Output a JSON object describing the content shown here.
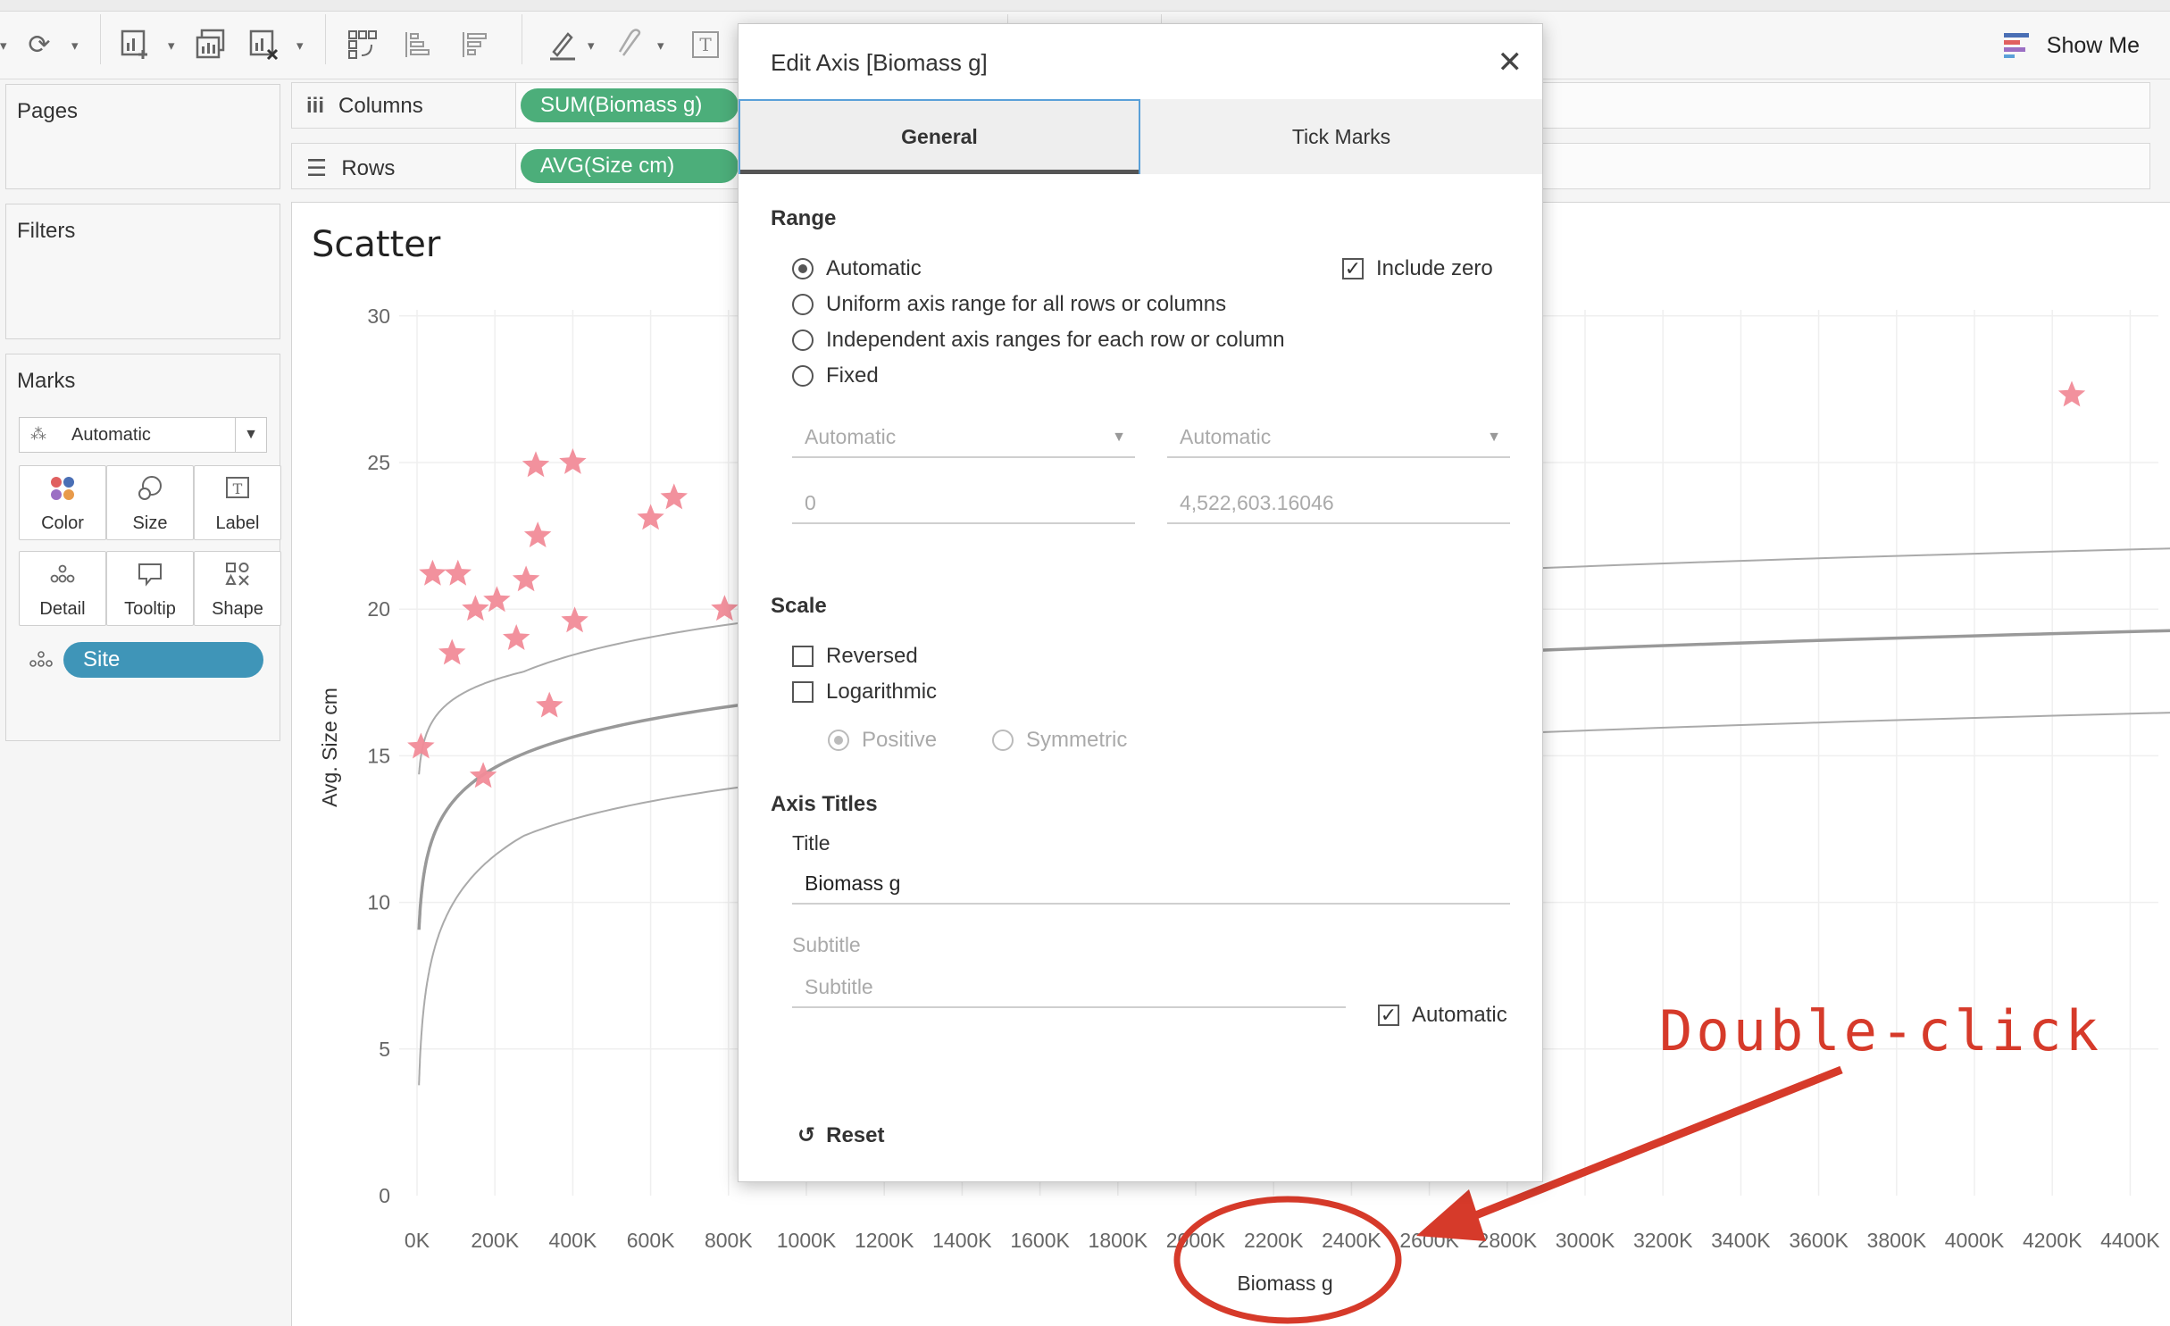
{
  "toolbar": {
    "icons": [
      "redo-icon",
      "new-worksheet-icon",
      "duplicate-sheet-icon",
      "clear-sheet-icon",
      "swap-icon",
      "sort-ascending-icon",
      "sort-descending-icon",
      "highlight-icon",
      "pin-icon",
      "text-label-icon"
    ],
    "show_me": "Show Me"
  },
  "pages": {
    "title": "Pages"
  },
  "filters": {
    "title": "Filters"
  },
  "marks": {
    "title": "Marks",
    "type": "Automatic",
    "cards": [
      {
        "label": "Color",
        "icon": "color-icon"
      },
      {
        "label": "Size",
        "icon": "size-icon"
      },
      {
        "label": "Label",
        "icon": "label-icon"
      },
      {
        "label": "Detail",
        "icon": "detail-icon"
      },
      {
        "label": "Tooltip",
        "icon": "tooltip-icon"
      },
      {
        "label": "Shape",
        "icon": "shape-icon"
      }
    ],
    "detail_pill": "Site"
  },
  "shelves": {
    "columns_label": "Columns",
    "columns_pill": "SUM(Biomass g)",
    "rows_label": "Rows",
    "rows_pill": "AVG(Size cm)"
  },
  "view": {
    "title": "Scatter"
  },
  "chart_data": {
    "type": "scatter",
    "xlabel": "Biomass g",
    "ylabel": "Avg. Size cm",
    "xlim": [
      0,
      4500000
    ],
    "ylim": [
      0,
      31
    ],
    "x_tick_labels": [
      "0K",
      "200K",
      "400K",
      "600K",
      "800K",
      "1000K",
      "1200K",
      "1400K",
      "1600K",
      "1800K",
      "2000K",
      "2200K",
      "2400K",
      "2600K",
      "2800K",
      "3000K",
      "3200K",
      "3400K",
      "3600K",
      "3800K",
      "4000K",
      "4200K",
      "4400K"
    ],
    "y_tick_labels": [
      "0",
      "5",
      "10",
      "15",
      "20",
      "25",
      "30"
    ],
    "points": [
      {
        "x": 10000,
        "y": 15.3
      },
      {
        "x": 40000,
        "y": 21.2
      },
      {
        "x": 90000,
        "y": 18.5
      },
      {
        "x": 105000,
        "y": 21.2
      },
      {
        "x": 150000,
        "y": 20.0
      },
      {
        "x": 170000,
        "y": 14.3
      },
      {
        "x": 205000,
        "y": 20.3
      },
      {
        "x": 255000,
        "y": 19.0
      },
      {
        "x": 280000,
        "y": 21.0
      },
      {
        "x": 305000,
        "y": 24.9
      },
      {
        "x": 310000,
        "y": 22.5
      },
      {
        "x": 340000,
        "y": 16.7
      },
      {
        "x": 400000,
        "y": 25.0
      },
      {
        "x": 405000,
        "y": 19.6
      },
      {
        "x": 600000,
        "y": 23.1
      },
      {
        "x": 660000,
        "y": 23.8
      },
      {
        "x": 790000,
        "y": 20.0
      },
      {
        "x": 4250000,
        "y": 27.3
      }
    ],
    "trend": {
      "type": "logarithmic",
      "confidence_bands": true
    },
    "marker": "star",
    "marker_color": "#f18b98",
    "grid": true
  },
  "dialog": {
    "title": "Edit Axis [Biomass g]",
    "tabs": [
      "General",
      "Tick Marks"
    ],
    "active_tab": "General",
    "range": {
      "heading": "Range",
      "options": [
        "Automatic",
        "Uniform axis range for all rows or columns",
        "Independent axis ranges for each row or column",
        "Fixed"
      ],
      "selected": "Automatic",
      "include_zero": "Include zero",
      "start_select": "Automatic",
      "end_select": "Automatic",
      "start_value": "0",
      "end_value": "4,522,603.16046"
    },
    "scale": {
      "heading": "Scale",
      "reversed": "Reversed",
      "logarithmic": "Logarithmic",
      "positive": "Positive",
      "symmetric": "Symmetric"
    },
    "axis_titles": {
      "heading": "Axis Titles",
      "title_label": "Title",
      "title_value": "Biomass g",
      "subtitle_label": "Subtitle",
      "subtitle_placeholder": "Subtitle",
      "automatic": "Automatic"
    },
    "reset": "Reset"
  },
  "annotation": {
    "text": "Double-click",
    "color": "#d63a2a"
  },
  "colors": {
    "pill_green": "#4cae7a",
    "pill_blue": "#3f95b8",
    "tab_focus": "#5aa0d8"
  }
}
